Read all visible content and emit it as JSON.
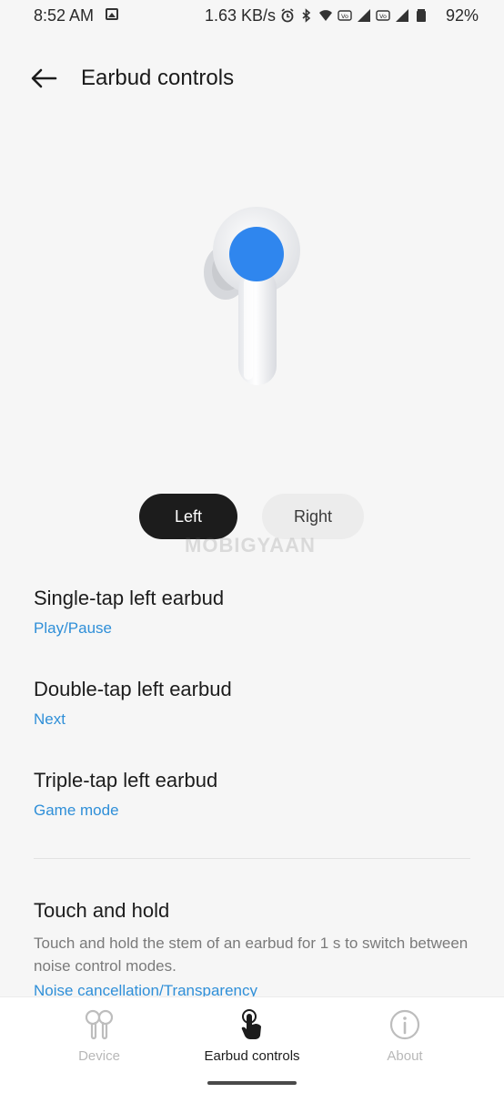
{
  "status_bar": {
    "time": "8:52 AM",
    "speed": "1.63 KB/s",
    "battery": "92%",
    "icons": [
      "gallery-icon",
      "alarm-icon",
      "bluetooth-icon",
      "wifi-icon",
      "volte-icon",
      "signal-icon",
      "volte-icon",
      "signal-icon",
      "battery-icon"
    ]
  },
  "header": {
    "title": "Earbud controls"
  },
  "tabs": {
    "left": "Left",
    "right": "Right",
    "selected": "Left"
  },
  "watermark": "MOBIGYAAN",
  "settings": {
    "single_tap": {
      "title": "Single-tap left earbud",
      "value": "Play/Pause"
    },
    "double_tap": {
      "title": "Double-tap left earbud",
      "value": "Next"
    },
    "triple_tap": {
      "title": "Triple-tap left earbud",
      "value": "Game mode"
    },
    "touch_hold": {
      "title": "Touch and hold",
      "description": "Touch and hold the stem of an earbud for 1 s to switch between noise control modes.",
      "value": "Noise cancellation/Transparency"
    }
  },
  "bottom_nav": {
    "device": "Device",
    "controls": "Earbud controls",
    "about": "About",
    "active": "Earbud controls"
  },
  "colors": {
    "accent_blue": "#2f8fd8",
    "earbud_dot": "#2f86ee",
    "selected_tab": "#1c1c1c"
  }
}
